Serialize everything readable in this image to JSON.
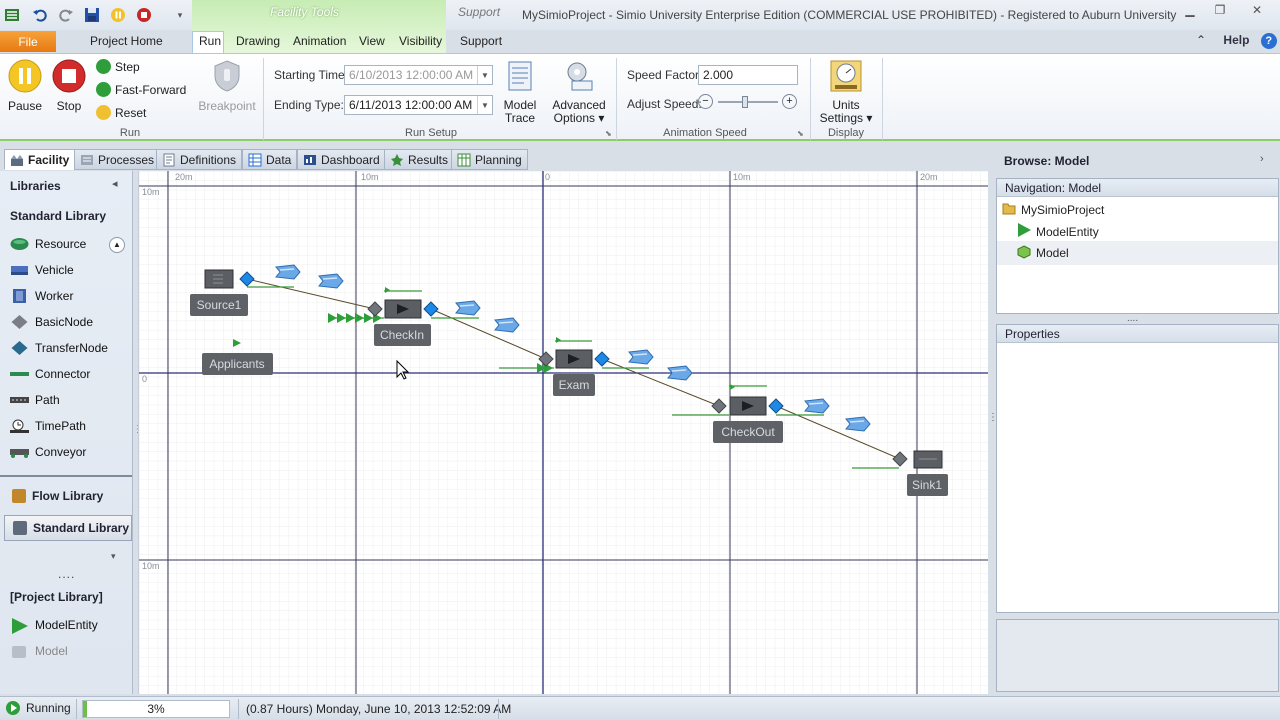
{
  "titlebar": {
    "contextual_group": "Facility Tools",
    "support_group": "Support",
    "window_title": "MySimioProject - Simio University Enterprise Edition (COMMERCIAL USE PROHIBITED) - Registered to Auburn University"
  },
  "ribbon_tabs": {
    "file": "File",
    "tabs": [
      "Project Home",
      "Run",
      "Drawing",
      "Animation",
      "View",
      "Visibility",
      "Support"
    ],
    "active": "Run",
    "help": "Help"
  },
  "run_group": {
    "pause": "Pause",
    "stop": "Stop",
    "step": "Step",
    "fast_forward": "Fast-Forward",
    "reset": "Reset",
    "label": "Run",
    "breakpoint": "Breakpoint"
  },
  "run_setup": {
    "starting_time_label": "Starting Time:",
    "starting_time_value": "6/10/2013 12:00:00 AM",
    "ending_type_label": "Ending Type:",
    "ending_type_value": "6/11/2013 12:00:00 AM",
    "model_trace": [
      "Model",
      "Trace"
    ],
    "advanced_options": [
      "Advanced",
      "Options"
    ],
    "label": "Run Setup"
  },
  "animation_speed": {
    "speed_factor_label": "Speed Factor:",
    "speed_factor_value": "2.000",
    "adjust_speed_label": "Adjust Speed:",
    "slider_level": 0.45,
    "label": "Animation Speed"
  },
  "display_group": {
    "units_settings": [
      "Units",
      "Settings"
    ],
    "label": "Display"
  },
  "doc_tabs": [
    "Facility",
    "Processes",
    "Definitions",
    "Data",
    "Dashboard",
    "Results",
    "Planning"
  ],
  "libraries": {
    "title": "Libraries",
    "standard_library_heading": "Standard Library",
    "items": [
      "Resource",
      "Vehicle",
      "Worker",
      "BasicNode",
      "TransferNode",
      "Connector",
      "Path",
      "TimePath",
      "Conveyor"
    ],
    "flow_library": "Flow Library",
    "standard_library_button": "Standard Library",
    "ellipsis": "....",
    "project_library_heading": "[Project Library]",
    "project_items": [
      "ModelEntity",
      "Model"
    ]
  },
  "canvas": {
    "ruler_top": [
      "20m",
      "10m",
      "0",
      "10m",
      "20m"
    ],
    "ruler_left": [
      "10m",
      "0",
      "10m"
    ],
    "objects": {
      "source": "Source1",
      "applicants": "Applicants",
      "checkin": "CheckIn",
      "exam": "Exam",
      "checkout": "CheckOut",
      "sink": "Sink1"
    }
  },
  "browse": {
    "title": "Browse: Model",
    "navigation_title": "Navigation: Model",
    "tree": [
      "MySimioProject",
      "ModelEntity",
      "Model"
    ],
    "properties_title": "Properties"
  },
  "statusbar": {
    "status": "Running",
    "progress_text": "3%",
    "progress": 0.03,
    "time": "(0.87 Hours) Monday, June 10, 2013 12:52:09 AM"
  },
  "colors": {
    "green_accent": "#8dcc6a",
    "file_orange": "#e77a12",
    "node_blue": "#1e88e5"
  }
}
